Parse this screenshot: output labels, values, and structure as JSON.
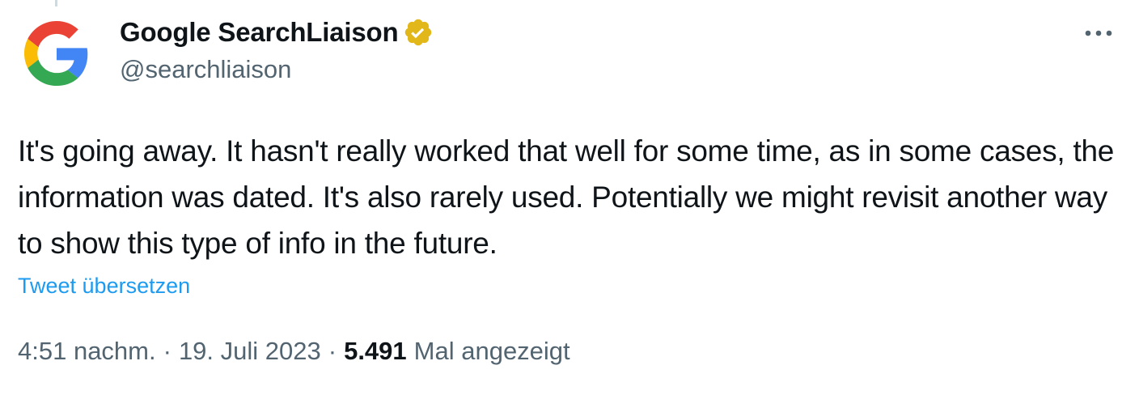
{
  "author": {
    "display_name": "Google SearchLiaison",
    "handle": "@searchliaison",
    "avatar_icon": "google-g-logo-icon",
    "verified_badge_icon": "gold-verified-badge-icon",
    "badge_color": "#e2b719"
  },
  "header": {
    "more_icon": "more-options-icon"
  },
  "tweet": {
    "text": "It's going away. It hasn't really worked that well for some time, as in some cases, the information was dated. It's also rarely used. Potentially we might revisit another way to show this type of info in the future.",
    "translate_label": "Tweet übersetzen"
  },
  "meta": {
    "time": "4:51 nachm.",
    "separator": "·",
    "date": "19. Juli 2023",
    "views_count": "5.491",
    "views_label": "Mal angezeigt"
  },
  "colors": {
    "text_primary": "#0f1419",
    "text_secondary": "#536471",
    "link": "#1d9bf0"
  }
}
